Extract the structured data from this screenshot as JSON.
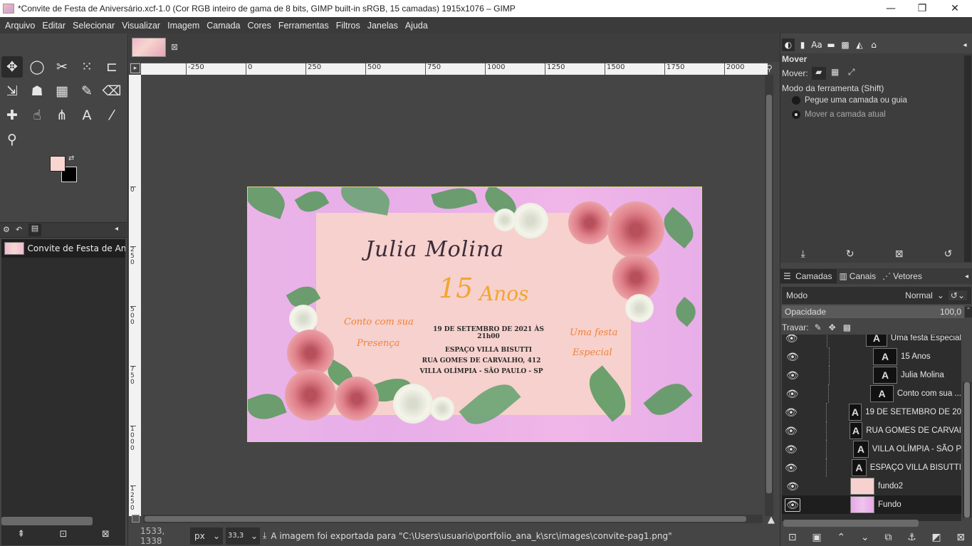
{
  "window": {
    "title": "*Convite de Festa de Aniversário.xcf-1.0 (Cor RGB inteiro de gama de 8 bits, GIMP built-in sRGB, 15 camadas) 1915x1076 – GIMP",
    "minimize": "—",
    "maximize": "❐",
    "close": "✕"
  },
  "menu": [
    "Arquivo",
    "Editar",
    "Selecionar",
    "Visualizar",
    "Imagem",
    "Camada",
    "Cores",
    "Ferramentas",
    "Filtros",
    "Janelas",
    "Ajuda"
  ],
  "colors": {
    "foreground": "#f8d6cf",
    "background": "#000000"
  },
  "images_dock": {
    "item": "Convite de Festa de Aniver"
  },
  "ruler_h": [
    "-250",
    "0",
    "250",
    "500",
    "750",
    "1000",
    "1250",
    "1500",
    "1750",
    "2000"
  ],
  "ruler_v": [
    "0",
    "250",
    "500",
    "750",
    "1000",
    "1250"
  ],
  "invite": {
    "name": "Julia Molina",
    "number": "15",
    "anos": "Anos",
    "left_script_1": "Conto com sua",
    "left_script_2": "Presença",
    "right_script_1": "Uma festa",
    "right_script_2": "Especial",
    "date": "19 DE SETEMBRO DE 2021 ÀS 21h00",
    "venue": "ESPAÇO VILLA BISUTTI",
    "street": "RUA GOMES DE CARVALHO, 412",
    "city": "VILLA OLÍMPIA - SÃO PAULO - SP"
  },
  "status": {
    "coords": "1533, 1338",
    "unit": "px",
    "zoom": "33,3 %",
    "message": "A imagem foi exportada para \"C:\\Users\\usuario\\portfolio_ana_k\\src\\images\\convite-pag1.png\""
  },
  "tool_options": {
    "title": "Mover",
    "mover_label": "Mover:",
    "mode_label": "Modo da ferramenta (Shift)",
    "option1": "Pegue uma camada ou guia",
    "option2": "Mover a camada atual"
  },
  "layer_tabs": [
    "Camadas",
    "Canais",
    "Vetores"
  ],
  "layer_panel": {
    "mode_label": "Modo",
    "mode_value": "Normal",
    "opacity_label": "Opacidade",
    "opacity_value": "100,0",
    "lock_label": "Travar:"
  },
  "layers": [
    {
      "name": "Uma festa Especial",
      "type": "text"
    },
    {
      "name": "15 Anos",
      "type": "text"
    },
    {
      "name": "Julia Molina",
      "type": "text"
    },
    {
      "name": "Conto com sua ...",
      "type": "text"
    },
    {
      "name": "19 DE SETEMBRO DE 20",
      "type": "text"
    },
    {
      "name": "RUA GOMES DE CARVAI",
      "type": "text"
    },
    {
      "name": "VILLA OLÍMPIA - SÃO P",
      "type": "text"
    },
    {
      "name": "ESPAÇO VILLA BISUTTI",
      "type": "text"
    },
    {
      "name": "fundo2",
      "type": "image"
    },
    {
      "name": "Fundo",
      "type": "image"
    }
  ]
}
